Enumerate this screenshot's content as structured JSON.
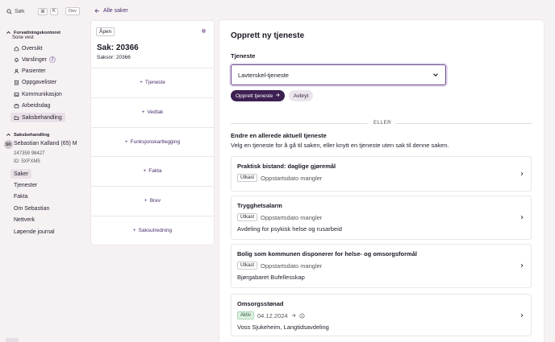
{
  "sidebar": {
    "search_placeholder": "Søk",
    "shortcut_keys": [
      "⌘",
      "K"
    ],
    "env_badge": "Dev",
    "office_section": {
      "title": "Forvaltningskontoret",
      "subtitle": "Sone vest"
    },
    "nav": [
      {
        "label": "Oversikt",
        "icon": "home-icon"
      },
      {
        "label": "Varslinger",
        "icon": "bell-icon",
        "count": "3"
      },
      {
        "label": "Pasienter",
        "icon": "user-icon"
      },
      {
        "label": "Oppgavelister",
        "icon": "clipboard-icon"
      },
      {
        "label": "Kommunikasjon",
        "icon": "inbox-icon"
      },
      {
        "label": "Arbeidsdag",
        "icon": "briefcase-icon"
      },
      {
        "label": "Saksbehandling",
        "icon": "folder-icon",
        "active": true
      }
    ],
    "case_section": {
      "title": "Saksbehandling"
    },
    "person": {
      "initials": "SK",
      "name": "Sebastian Kalland (65) M",
      "phone": "247359 98427",
      "id": "ID: 5XFXM5"
    },
    "person_nav": [
      {
        "label": "Saker",
        "active": true
      },
      {
        "label": "Tjenester"
      },
      {
        "label": "Fakta"
      },
      {
        "label": "Om Sebastian"
      },
      {
        "label": "Nettverk"
      },
      {
        "label": "Løpende journal"
      }
    ]
  },
  "back_link": "Alle saker",
  "case": {
    "status": "Åpen",
    "title": "Sak: 20366",
    "number": "Saksnr: 20366",
    "actions": [
      "Tjeneste",
      "Vedtak",
      "Funksjonskartlegging",
      "Fakta",
      "Brev",
      "Saksutredning"
    ]
  },
  "main": {
    "title": "Opprett ny tjeneste",
    "field_label": "Tjeneste",
    "selected_service": "Lavterskel-tjeneste",
    "create_button": "Opprett tjeneste",
    "cancel_button": "Avbryt",
    "or_text": "ELLER",
    "existing_heading": "Endre en allerede aktuell tjeneste",
    "existing_desc": "Velg en tjeneste for å gå til saken, eller knytt en tjeneste uten sak til denne saken.",
    "services": [
      {
        "name": "Praktisk bistand: daglige gjøremål",
        "badge": "Utkast",
        "status": "Oppstartsdato mangler",
        "sub": ""
      },
      {
        "name": "Trygghetsalarm",
        "badge": "Utkast",
        "status": "Oppstartsdato mangler",
        "sub": "Avdeling for psykisk helse og rusarbeid"
      },
      {
        "name": "Bolig som kommunen disponerer for helse- og omsorgsformål",
        "badge": "Utkast",
        "status": "Oppstartsdato mangler",
        "sub": "Bjørgabaret Bufellesskap"
      },
      {
        "name": "Omsorgsstønad",
        "badge": "Aktiv",
        "status": "04.12.2024",
        "sub": "Voss Sjukeheim, Langtidsavdeling"
      }
    ]
  },
  "colors": {
    "accent": "#3d2052",
    "link": "#4a2f6b",
    "background": "#f6f2f4",
    "active_nav": "#e9e1e7",
    "aktiv_badge": "#dff1e3"
  }
}
